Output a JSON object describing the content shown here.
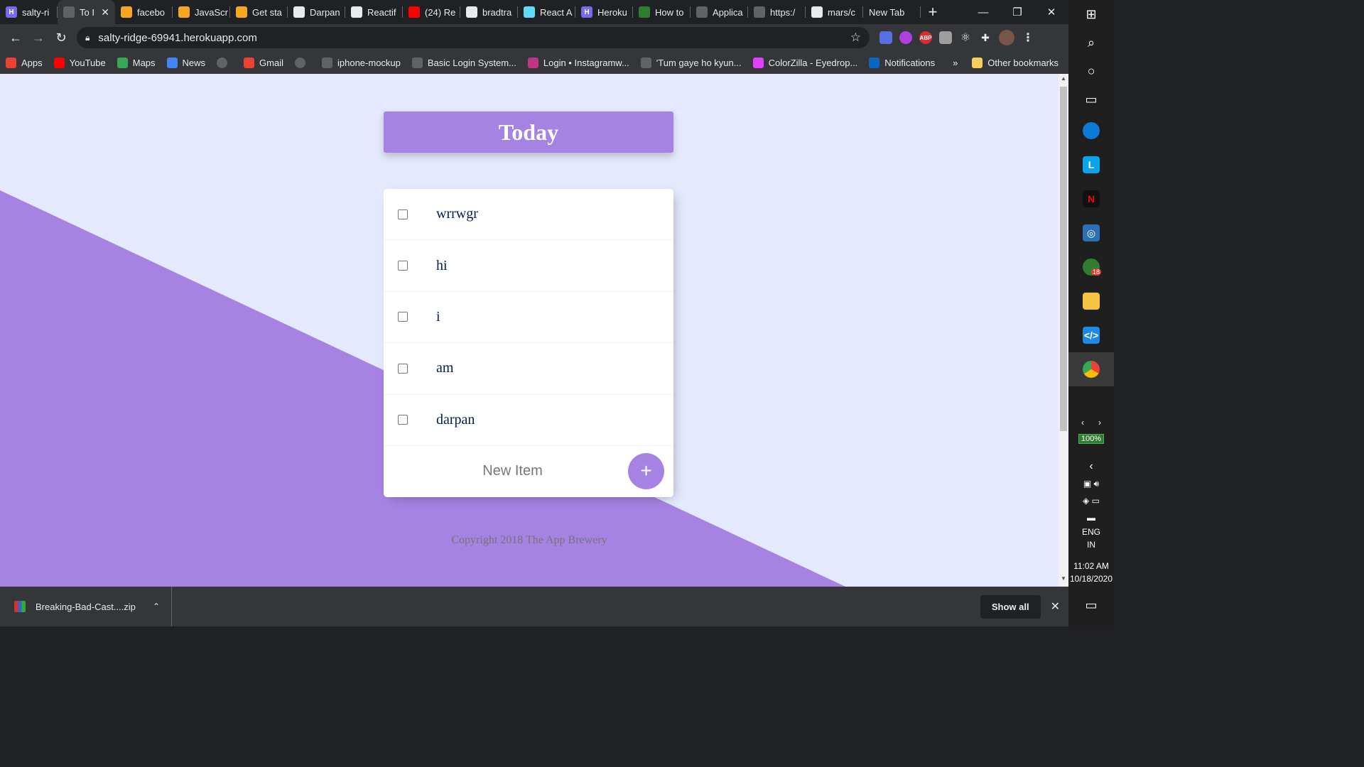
{
  "tabs": [
    {
      "title": "salty-ri",
      "color": "#7b68ee",
      "glyph": "H"
    },
    {
      "title": "To I",
      "color": "#5f6368",
      "glyph": "",
      "active": true
    },
    {
      "title": "facebo",
      "color": "#f5a623",
      "glyph": ""
    },
    {
      "title": "JavaScr",
      "color": "#f5a623",
      "glyph": ""
    },
    {
      "title": "Get sta",
      "color": "#f5a623",
      "glyph": ""
    },
    {
      "title": "Darpan",
      "color": "#ffffff",
      "glyph": ""
    },
    {
      "title": "Reactif",
      "color": "#ffffff",
      "glyph": ""
    },
    {
      "title": "(24) Re",
      "color": "#ff0000",
      "glyph": ""
    },
    {
      "title": "bradtra",
      "color": "#ffffff",
      "glyph": ""
    },
    {
      "title": "React A",
      "color": "#61dafb",
      "glyph": ""
    },
    {
      "title": "Heroku",
      "color": "#7b68ee",
      "glyph": "H"
    },
    {
      "title": "How to",
      "color": "#2e7d32",
      "glyph": ""
    },
    {
      "title": "Applica",
      "color": "#5f6368",
      "glyph": ""
    },
    {
      "title": "https:/",
      "color": "#5f6368",
      "glyph": ""
    },
    {
      "title": "mars/c",
      "color": "#ffffff",
      "glyph": ""
    },
    {
      "title": "New Tab",
      "color": "",
      "glyph": ""
    }
  ],
  "omnibox": {
    "url": "salty-ridge-69941.herokuapp.com"
  },
  "bookmarks": [
    {
      "label": "Apps",
      "color": "#ea4335"
    },
    {
      "label": "YouTube",
      "color": "#ff0000"
    },
    {
      "label": "Maps",
      "color": "#34a853"
    },
    {
      "label": "News",
      "color": "#4285f4"
    },
    {
      "label": "",
      "color": "#5f6368"
    },
    {
      "label": "Gmail",
      "color": "#ea4335"
    },
    {
      "label": "",
      "color": "#5f6368"
    },
    {
      "label": "iphone-mockup",
      "color": "#5f6368"
    },
    {
      "label": "Basic Login System...",
      "color": "#5f6368"
    },
    {
      "label": "Login • Instagramw...",
      "color": "#c13584"
    },
    {
      "label": "'Tum gaye ho kyun...",
      "color": "#5f6368"
    },
    {
      "label": "ColorZilla - Eyedrop...",
      "color": "#e040fb"
    },
    {
      "label": "Notifications",
      "color": "#0a66c2"
    }
  ],
  "bookmarks_more": "»",
  "other_bookmarks": "Other bookmarks",
  "page": {
    "heading": "Today",
    "items": [
      "wrrwgr",
      "hi",
      "i",
      "am",
      "darpan"
    ],
    "new_item_placeholder": "New Item",
    "add_symbol": "+",
    "footer": "Copyright 2018 The App Brewery",
    "accent": "#A683E3",
    "background": "#E4E9FD"
  },
  "downloads": {
    "file": "Breaking-Bad-Cast....zip",
    "show_all": "Show all"
  },
  "taskbar": {
    "battery": "100%",
    "lang1": "ENG",
    "lang2": "IN",
    "time": "11:02 AM",
    "date": "10/18/2020",
    "badge": "18"
  }
}
